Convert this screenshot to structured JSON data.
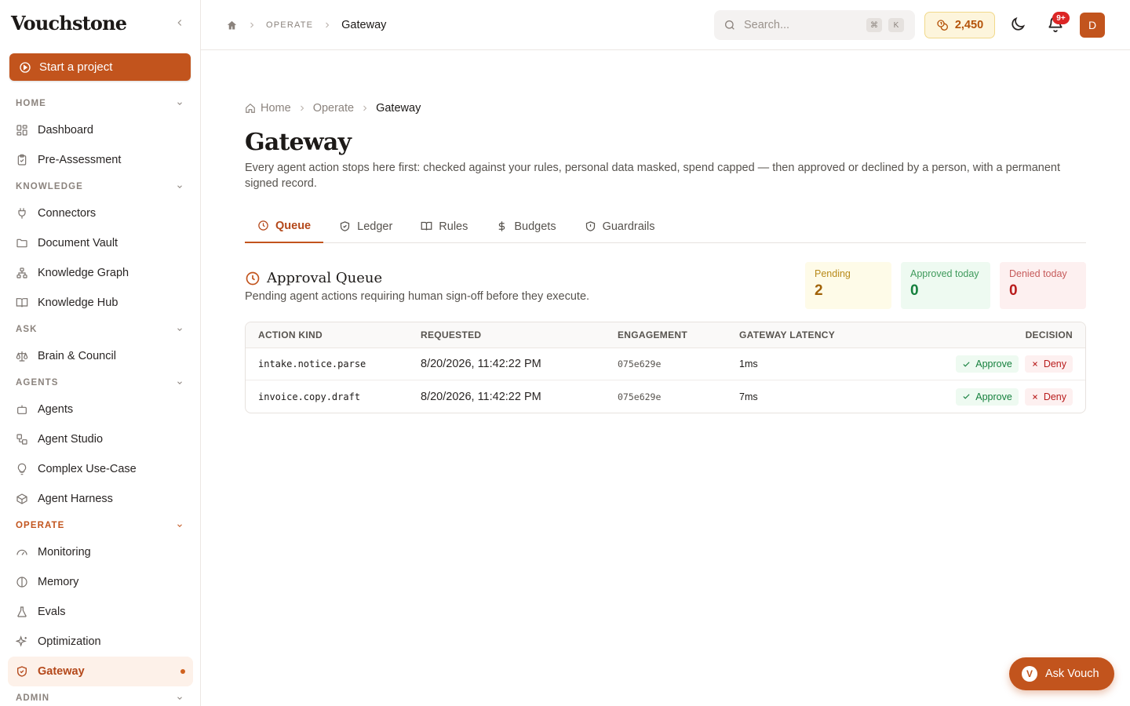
{
  "app": {
    "logo_text": "Vouchstone"
  },
  "sidebar": {
    "start_button": "Start a project",
    "sections": {
      "home": "HOME",
      "knowledge": "KNOWLEDGE",
      "ask": "ASK",
      "agents": "AGENTS",
      "operate": "OPERATE",
      "admin": "ADMIN"
    },
    "items": {
      "dashboard": "Dashboard",
      "pre_assessment": "Pre-Assessment",
      "connectors": "Connectors",
      "document_vault": "Document Vault",
      "knowledge_graph": "Knowledge Graph",
      "knowledge_hub": "Knowledge Hub",
      "brain_council": "Brain & Council",
      "agents": "Agents",
      "agent_studio": "Agent Studio",
      "complex_use_case": "Complex Use-Case",
      "agent_harness": "Agent Harness",
      "monitoring": "Monitoring",
      "memory": "Memory",
      "evals": "Evals",
      "optimization": "Optimization",
      "gateway": "Gateway"
    }
  },
  "topbar": {
    "breadcrumb_section": "OPERATE",
    "breadcrumb_current": "Gateway",
    "search_placeholder": "Search...",
    "shortcut_keys": [
      "⌘",
      "K"
    ],
    "credits": "2,450",
    "notification_badge": "9+",
    "avatar_initial": "D"
  },
  "page": {
    "breadcrumb": [
      "Home",
      "Operate",
      "Gateway"
    ],
    "title": "Gateway",
    "description": "Every agent action stops here first: checked against your rules, personal data masked, spend capped — then approved or declined by a person, with a permanent signed record.",
    "tabs": [
      "Queue",
      "Ledger",
      "Rules",
      "Budgets",
      "Guardrails"
    ],
    "active_tab": "Queue"
  },
  "queue": {
    "title": "Approval Queue",
    "description": "Pending agent actions requiring human sign-off before they execute.",
    "stats": {
      "pending_label": "Pending",
      "pending_value": "2",
      "approved_label": "Approved today",
      "approved_value": "0",
      "denied_label": "Denied today",
      "denied_value": "0"
    },
    "columns": [
      "ACTION KIND",
      "REQUESTED",
      "ENGAGEMENT",
      "GATEWAY LATENCY",
      "DECISION"
    ],
    "rows": [
      {
        "action": "intake.notice.parse",
        "requested": "8/20/2026, 11:42:22 PM",
        "engagement": "075e629e",
        "latency": "1ms"
      },
      {
        "action": "invoice.copy.draft",
        "requested": "8/20/2026, 11:42:22 PM",
        "engagement": "075e629e",
        "latency": "7ms"
      }
    ],
    "approve_label": "Approve",
    "deny_label": "Deny"
  },
  "assistant": {
    "button_label": "Ask Vouch",
    "icon_letter": "V"
  },
  "colors": {
    "accent": "#c2541d",
    "pending": "#a16207",
    "approved": "#15803d",
    "denied": "#b91c1c"
  }
}
